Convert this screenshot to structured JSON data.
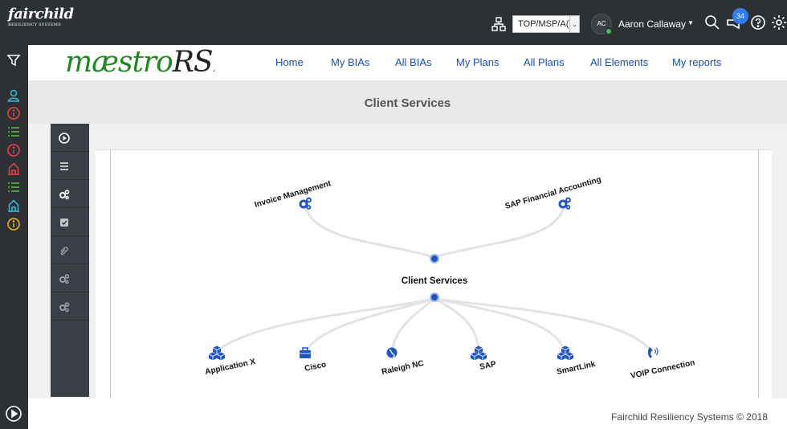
{
  "brand": {
    "name": "fairchild",
    "tagline": "RESILIENCY SYSTEMS"
  },
  "topbar": {
    "org_select": "TOP/MSP/A(",
    "user_initials": "AC",
    "user_name": "Aaron Callaway",
    "notification_count": "34",
    "status_color": "#39c15a"
  },
  "logo": {
    "main": "mæstro",
    "suffix": "RS",
    "trademark": "."
  },
  "nav": [
    "Home",
    "My BIAs",
    "All BIAs",
    "My Plans",
    "All Plans",
    "All Elements",
    "My reports"
  ],
  "page_title": "Client Services",
  "rail_icons": [
    {
      "name": "user-icon",
      "color": "#3fb8e0"
    },
    {
      "name": "info-icon",
      "color": "#e8434a"
    },
    {
      "name": "list-icon",
      "color": "#58c243"
    },
    {
      "name": "info-icon",
      "color": "#e8434a"
    },
    {
      "name": "building-icon",
      "color": "#e8434a"
    },
    {
      "name": "list-icon",
      "color": "#58c243"
    },
    {
      "name": "building-icon",
      "color": "#3fb8e0"
    },
    {
      "name": "info-icon",
      "color": "#f0b418"
    }
  ],
  "graph": {
    "center": "Client Services",
    "upstream": [
      "Invoice Management",
      "SAP Financial Accounting"
    ],
    "downstream": [
      {
        "label": "Application X",
        "icon": "cubes-icon"
      },
      {
        "label": "Cisco",
        "icon": "briefcase-icon"
      },
      {
        "label": "Raleigh NC",
        "icon": "globe-icon"
      },
      {
        "label": "SAP",
        "icon": "cubes-icon"
      },
      {
        "label": "SmartLink",
        "icon": "cubes-icon"
      },
      {
        "label": "VOIP Connection",
        "icon": "phone-icon"
      }
    ]
  },
  "footer": "Fairchild Resiliency Systems © 2018"
}
